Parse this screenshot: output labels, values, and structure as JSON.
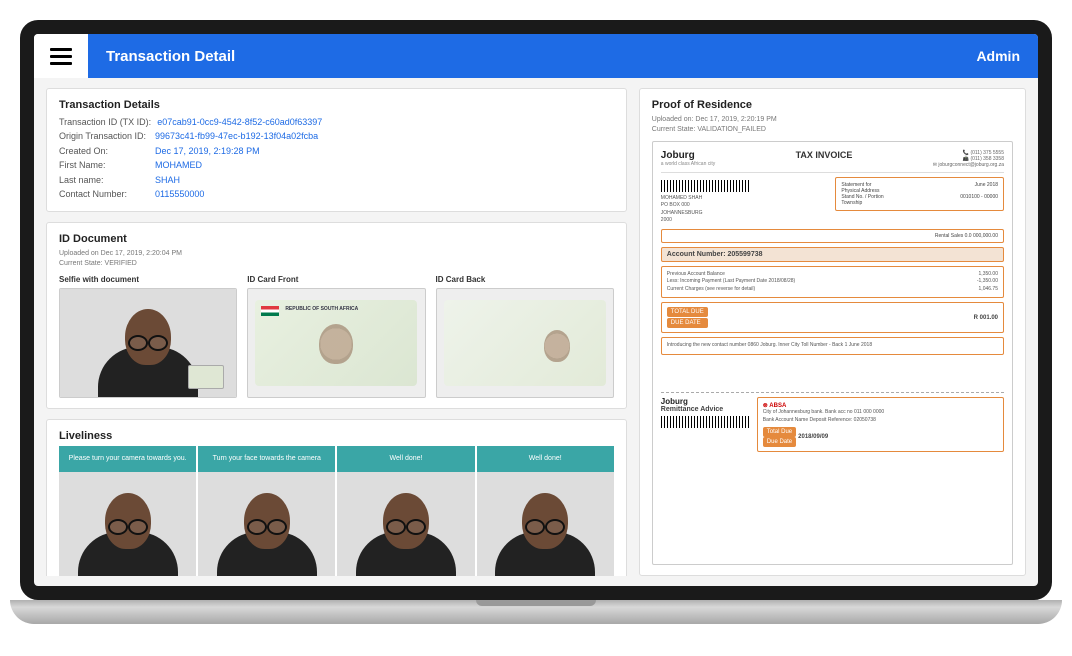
{
  "header": {
    "title": "Transaction Detail",
    "user": "Admin"
  },
  "transaction_details": {
    "title": "Transaction Details",
    "rows": [
      {
        "label": "Transaction ID (TX ID):",
        "value": "e07cab91-0cc9-4542-8f52-c60ad0f63397"
      },
      {
        "label": "Origin Transaction ID:",
        "value": "99673c41-fb99-47ec-b192-13f04a02fcba"
      },
      {
        "label": "Created On:",
        "value": "Dec 17, 2019, 2:19:28 PM"
      },
      {
        "label": "First Name:",
        "value": "MOHAMED"
      },
      {
        "label": "Last name:",
        "value": "SHAH"
      },
      {
        "label": "Contact Number:",
        "value": "0115550000"
      }
    ]
  },
  "id_document": {
    "title": "ID Document",
    "uploaded": "Uploaded on Dec 17, 2019, 2:20:04 PM",
    "state": "Current State: VERIFIED",
    "cols": [
      "Selfie with document",
      "ID Card Front",
      "ID Card Back"
    ],
    "id_header": "REPUBLIC OF SOUTH AFRICA"
  },
  "liveness": {
    "title": "Liveliness",
    "steps": [
      "Please turn your camera towards you.",
      "Turn your face towards the camera",
      "Well done!",
      "Well done!"
    ]
  },
  "proof": {
    "title": "Proof of Residence",
    "uploaded": "Uploaded on: Dec 17, 2019, 2:20:19 PM",
    "state": "Current State: VALIDATION_FAILED"
  },
  "invoice": {
    "logo": "Joburg",
    "doc_title": "TAX INVOICE",
    "phone1": "(011) 375 5555",
    "phone2": "(011) 358 3358",
    "email": "joburgconnect@joburg.org.za",
    "account_label": "Account Number: 205599738",
    "balance_lines": [
      "Previous Account Balance",
      "Less: Incoming Payment (Last Payment Date 2018/08/28)",
      "Current Charges (see reverse for detail)"
    ],
    "amounts": [
      "1,350.00",
      "-1,350.00",
      "1,046.75"
    ],
    "total_label": "TOTAL DUE",
    "due_label": "DUE DATE",
    "remit_title": "Remittance Advice",
    "bank": "ABSA",
    "total_due_label": "Total Due",
    "due_date_label": "Due Date",
    "due_date": "2018/09/09",
    "meta_labels": [
      "Statement for",
      "Physical Address",
      "Stand No. / Portion",
      "Township"
    ],
    "meta_values": [
      "June 2018",
      "",
      "0010100 - 00000",
      ""
    ],
    "rental_label": "Rental Sales 0.0 000,000.00"
  }
}
